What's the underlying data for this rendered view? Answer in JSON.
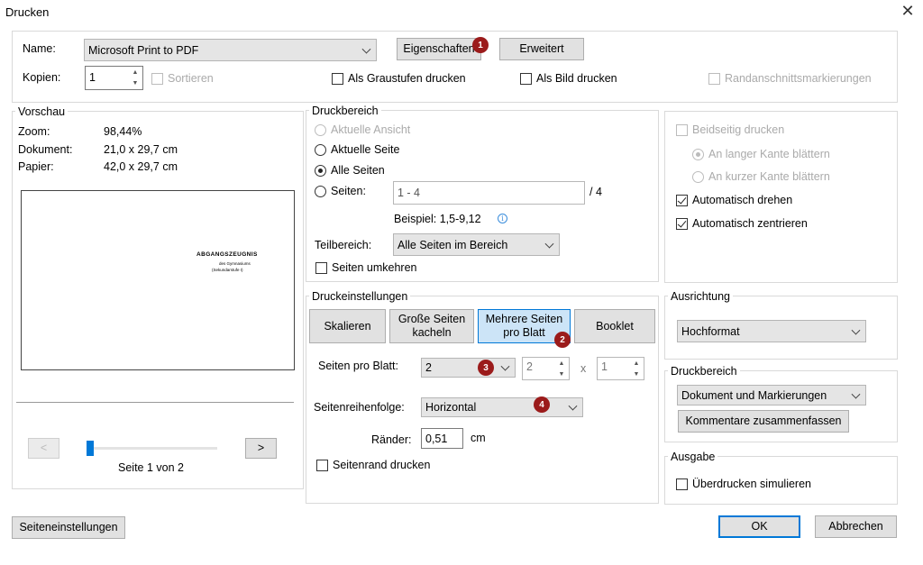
{
  "dialog": {
    "title": "Drucken",
    "close_label": "✕"
  },
  "printer": {
    "name_label": "Name:",
    "name_value": "Microsoft Print to PDF",
    "properties_label": "Eigenschaften",
    "advanced_label": "Erweitert",
    "copies_label": "Kopien:",
    "copies_value": "1",
    "sort_label": "Sortieren",
    "grayscale_label": "Als Graustufen drucken",
    "as_image_label": "Als Bild drucken",
    "crop_marks_label": "Randanschnittsmarkierungen"
  },
  "preview": {
    "group_label": "Vorschau",
    "zoom_label": "Zoom:",
    "zoom_value": "98,44%",
    "document_label": "Dokument:",
    "document_value": "21,0 x 29,7 cm",
    "paper_label": "Papier:",
    "paper_value": "42,0 x 29,7 cm",
    "page_heading": "ABGANGSZEUGNIS",
    "page_line1": "des Gymnasiums",
    "page_line2": "(Sekundarstufe I)",
    "prev_label": "<",
    "next_label": ">",
    "page_indicator": "Seite 1 von 2",
    "current_page": 1,
    "total_pages": 2
  },
  "print_range": {
    "group_label": "Druckbereich",
    "current_view_label": "Aktuelle Ansicht",
    "current_page_label": "Aktuelle Seite",
    "all_pages_label": "Alle Seiten",
    "pages_label": "Seiten:",
    "pages_value": "1 - 4",
    "pages_total": "/ 4",
    "example_text": "Beispiel: 1,5-9,12",
    "info_icon": "i",
    "subset_label": "Teilbereich:",
    "subset_value": "Alle Seiten im Bereich",
    "reverse_label": "Seiten umkehren"
  },
  "print_settings": {
    "group_label": "Druckeinstellungen",
    "tabs": [
      "Skalieren",
      "Große Seiten kacheln",
      "Mehrere Seiten pro Blatt",
      "Booklet"
    ],
    "pages_per_sheet_label": "Seiten pro Blatt:",
    "pages_per_sheet_value": "2",
    "columns_value": "2",
    "x_label": "x",
    "rows_value": "1",
    "page_order_label": "Seitenreihenfolge:",
    "page_order_value": "Horizontal",
    "margins_label": "Ränder:",
    "margins_value": "0,51",
    "margins_unit": "cm",
    "page_border_label": "Seitenrand drucken"
  },
  "duplex": {
    "two_sided_label": "Beidseitig drucken",
    "long_edge_label": "An langer Kante blättern",
    "short_edge_label": "An kurzer Kante blättern",
    "auto_rotate_label": "Automatisch drehen",
    "auto_center_label": "Automatisch zentrieren"
  },
  "orientation": {
    "group_label": "Ausrichtung",
    "value": "Hochformat"
  },
  "print_what": {
    "group_label": "Druckbereich",
    "value": "Dokument und Markierungen",
    "summarize_label": "Kommentare zusammenfassen"
  },
  "output": {
    "group_label": "Ausgabe",
    "overprint_label": "Überdrucken simulieren"
  },
  "footer": {
    "page_setup_label": "Seiteneinstellungen",
    "ok_label": "OK",
    "cancel_label": "Abbrechen"
  },
  "badges": [
    "1",
    "2",
    "3",
    "4"
  ],
  "colors": {
    "badge": "#9b1b1b",
    "accent": "#0078d7",
    "active_tab": "#cce4f7"
  }
}
